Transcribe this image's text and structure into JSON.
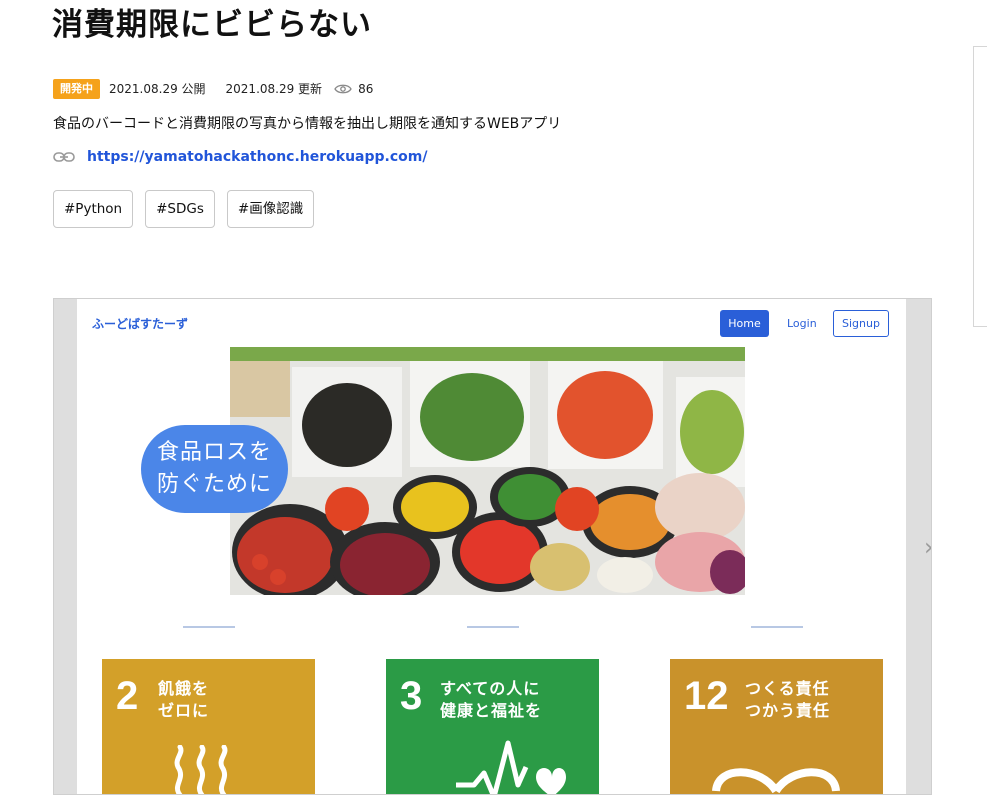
{
  "header": {
    "title": "消費期限にビビらない"
  },
  "meta": {
    "status_badge": "開発中",
    "published": "2021.08.29 公開",
    "updated": "2021.08.29 更新",
    "views": "86"
  },
  "description": "食品のバーコードと消費期限の写真から情報を抽出し期限を通知するWEBアプリ",
  "link": {
    "url": "https://yamatohackathonc.herokuapp.com/"
  },
  "tags": [
    "#Python",
    "#SDGs",
    "#画像認識"
  ],
  "preview": {
    "brand": "ふーどばすたーず",
    "nav": {
      "home": "Home",
      "login": "Login",
      "signup": "Signup"
    },
    "hero_caption_line1": "食品ロスを",
    "hero_caption_line2": "防ぐために",
    "sdg_cards": [
      {
        "number": "2",
        "line1": "飢餓を",
        "line2": "ゼロに",
        "color": "#d3a029"
      },
      {
        "number": "3",
        "line1": "すべての人に",
        "line2": "健康と福祉を",
        "color": "#2b9b46"
      },
      {
        "number": "12",
        "line1": "つくる責任",
        "line2": "つかう責任",
        "color": "#c9922b"
      }
    ]
  },
  "colors": {
    "badge": "#f5a21b",
    "link": "#2155d9",
    "accent_blue": "#2a5fd8"
  }
}
